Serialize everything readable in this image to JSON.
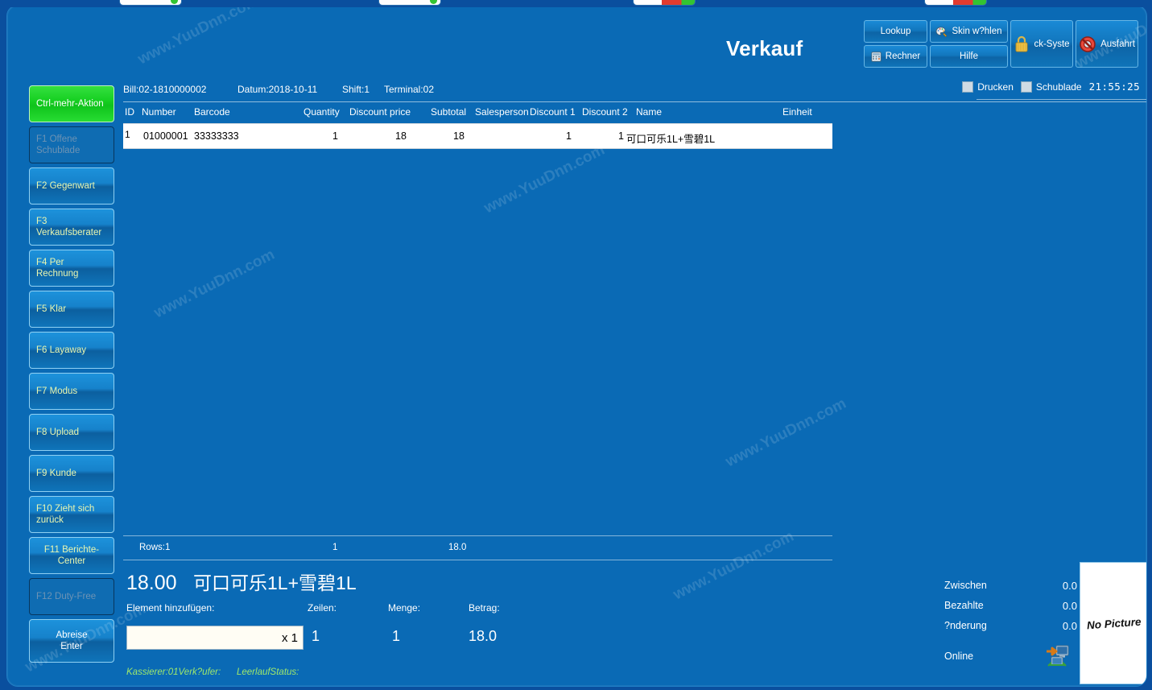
{
  "window": {
    "title": "Verkauf"
  },
  "header": {
    "buttons": [
      {
        "label": "Lookup",
        "icon": ""
      },
      {
        "label": "Skin w?hlen",
        "icon": "palette-icon"
      },
      {
        "label": "Rechner",
        "icon": "calculator-icon"
      },
      {
        "label": "Hilfe",
        "icon": ""
      },
      {
        "label": "ck-Syste",
        "icon": "lock-icon"
      },
      {
        "label": "Ausfahrt",
        "icon": "exit-icon"
      }
    ],
    "checkboxes": [
      {
        "label": "Drucken",
        "checked": false
      },
      {
        "label": "Schublade",
        "checked": false
      }
    ],
    "clock": "21:55:25"
  },
  "sidebar": {
    "items": [
      {
        "label": "Ctrl-mehr-Aktion",
        "style": "green",
        "enabled": true
      },
      {
        "label": "F1 Offene Schublade",
        "style": "disabled",
        "enabled": false
      },
      {
        "label": "F2 Gegenwart",
        "style": "normal",
        "enabled": true
      },
      {
        "label": "F3 Verkaufsberater",
        "style": "normal",
        "enabled": true
      },
      {
        "label": "F4 Per Rechnung",
        "style": "normal",
        "enabled": true
      },
      {
        "label": "F5 Klar",
        "style": "normal",
        "enabled": true
      },
      {
        "label": "F6 Layaway",
        "style": "normal",
        "enabled": true
      },
      {
        "label": "F7 Modus",
        "style": "normal",
        "enabled": true
      },
      {
        "label": "F8 Upload",
        "style": "normal",
        "enabled": true
      },
      {
        "label": "F9 Kunde",
        "style": "normal",
        "enabled": true
      },
      {
        "label": "F10 Zieht sich zurück",
        "style": "normal",
        "enabled": true
      },
      {
        "label": "F11 Berichte-Center",
        "style": "normal",
        "enabled": true
      },
      {
        "label": "F12 Duty-Free",
        "style": "disabled",
        "enabled": false
      },
      {
        "label": "Abreise\nEnter",
        "style": "enter",
        "enabled": true
      }
    ]
  },
  "bill": {
    "number": "Bill:02-1810000002",
    "date": "Datum:2018-10-11",
    "shift": "Shift:1",
    "terminal": "Terminal:02"
  },
  "table": {
    "columns": [
      "ID",
      "Number",
      "Barcode",
      "Quantity",
      "Discount price",
      "Subtotal",
      "Salesperson",
      "Discount 1",
      "Discount 2",
      "Name",
      "Einheit"
    ],
    "rows": [
      {
        "id": "1",
        "number": "01000001",
        "barcode": "33333333",
        "quantity": "1",
        "discount_price": "18",
        "subtotal": "18",
        "salesperson": "",
        "discount_1": "1",
        "discount_2": "1",
        "name": "可口可乐1L+雪碧1L",
        "einheit": ""
      }
    ],
    "footer": {
      "rows_label": "Rows:1",
      "quantity_total": "1",
      "amount_total": "18.0"
    }
  },
  "detail": {
    "price": "18.00",
    "name": "可口可乐1L+雪碧1L",
    "add_item_label": "Element hinzufügen:",
    "add_item_value": "x 1",
    "add_item_placeholder": "",
    "lines_label": "Zeilen:",
    "lines_value": "1",
    "quantity_label": "Menge:",
    "quantity_value": "1",
    "amount_label": "Betrag:",
    "amount_value": "18.0"
  },
  "status": {
    "cashier": "Kassierer:01Verk?ufer:",
    "idle": "LeerlaufStatus:"
  },
  "totals": {
    "rows": [
      {
        "label": "Zwischen",
        "value": "0.0"
      },
      {
        "label": "Bezahlte",
        "value": "0.0"
      },
      {
        "label": "?nderung",
        "value": "0.0"
      }
    ],
    "online_label": "Online",
    "picture_placeholder": "No Picture"
  },
  "watermarks": [
    "www.YuuDnn.com",
    "www.YuuDnn.com",
    "www.YuuDnn.com",
    "www.YuuDnn.com",
    "www.YuuDnn.com",
    "www.YuuDnn.com",
    "www.YuuDnn.com"
  ],
  "colors": {
    "background": "#0a6ab5",
    "outer": "#0a4f9e",
    "accent_green": "#17d022",
    "button_text": "#eaf7b0",
    "status_text": "#9fe86b"
  }
}
